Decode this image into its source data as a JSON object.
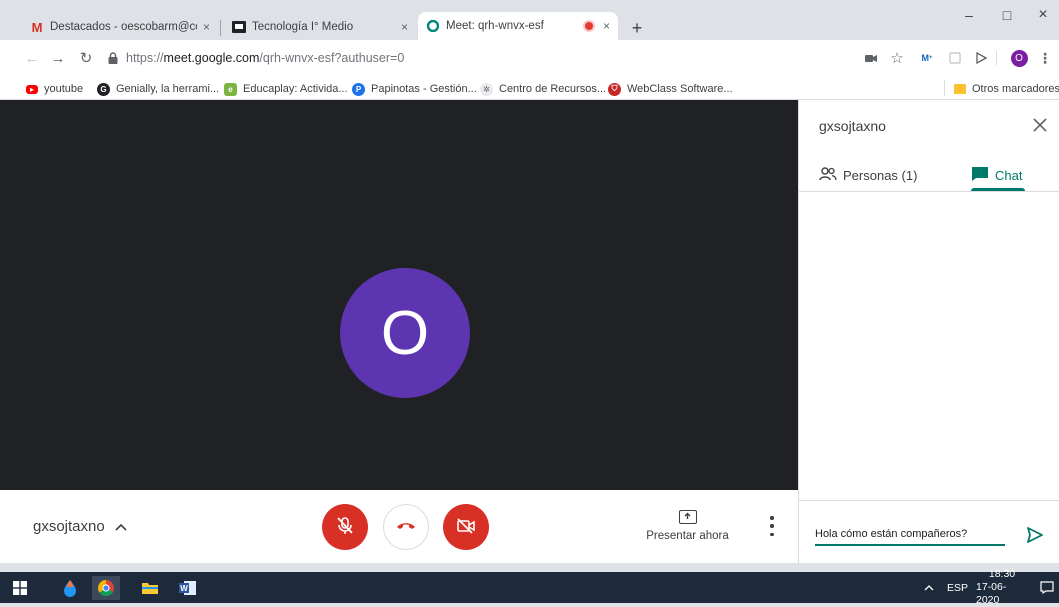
{
  "browser": {
    "tabs": [
      {
        "title": "Destacados - oescobarm@coleg",
        "close": "×",
        "favicon": "gmail-icon"
      },
      {
        "title": "Tecnología I° Medio",
        "close": "×",
        "favicon": "classroom-icon"
      },
      {
        "title": "Meet: qrh-wnvx-esf",
        "close": "×",
        "favicon": "meet-icon",
        "active": true
      }
    ],
    "new_tab": "+",
    "window_controls": {
      "minimize": "–",
      "maximize": "□",
      "close": "×"
    },
    "url": {
      "scheme": "https://",
      "host": "meet.google.com",
      "path": "/qrh-wnvx-esf?authuser=0"
    },
    "profile_initial": "O",
    "bookmarks": [
      {
        "label": "youtube",
        "icon": "youtube-icon",
        "color": "#ff0000"
      },
      {
        "label": "Genially, la herrami...",
        "icon": "genially-icon",
        "color": "#202124"
      },
      {
        "label": "Educaplay: Activida...",
        "icon": "educaplay-icon",
        "color": "#7cb342"
      },
      {
        "label": "Papinotas - Gestión...",
        "icon": "papinotas-icon",
        "color": "#1a73e8"
      },
      {
        "label": "Centro de Recursos...",
        "icon": "recursos-icon",
        "color": "#9aa0a6"
      },
      {
        "label": "WebClass Software...",
        "icon": "webclass-icon",
        "color": "#c62828"
      }
    ],
    "other_bookmarks": "Otros marcadores"
  },
  "meet": {
    "avatar_letter": "O",
    "avatar_color": "#5e35b1",
    "meeting_name": "gxsojtaxno",
    "present_label": "Presentar ahora",
    "panel": {
      "title": "gxsojtaxno",
      "people_tab": "Personas (1)",
      "chat_tab": "Chat",
      "chat_input_value": "Hola cómo están compañeros?"
    }
  },
  "taskbar": {
    "lang": "ESP",
    "time": "18:30",
    "date": "17-06-2020"
  },
  "colors": {
    "accent_teal": "#00796b",
    "danger_red": "#d93025",
    "stage_dark": "#202124"
  }
}
